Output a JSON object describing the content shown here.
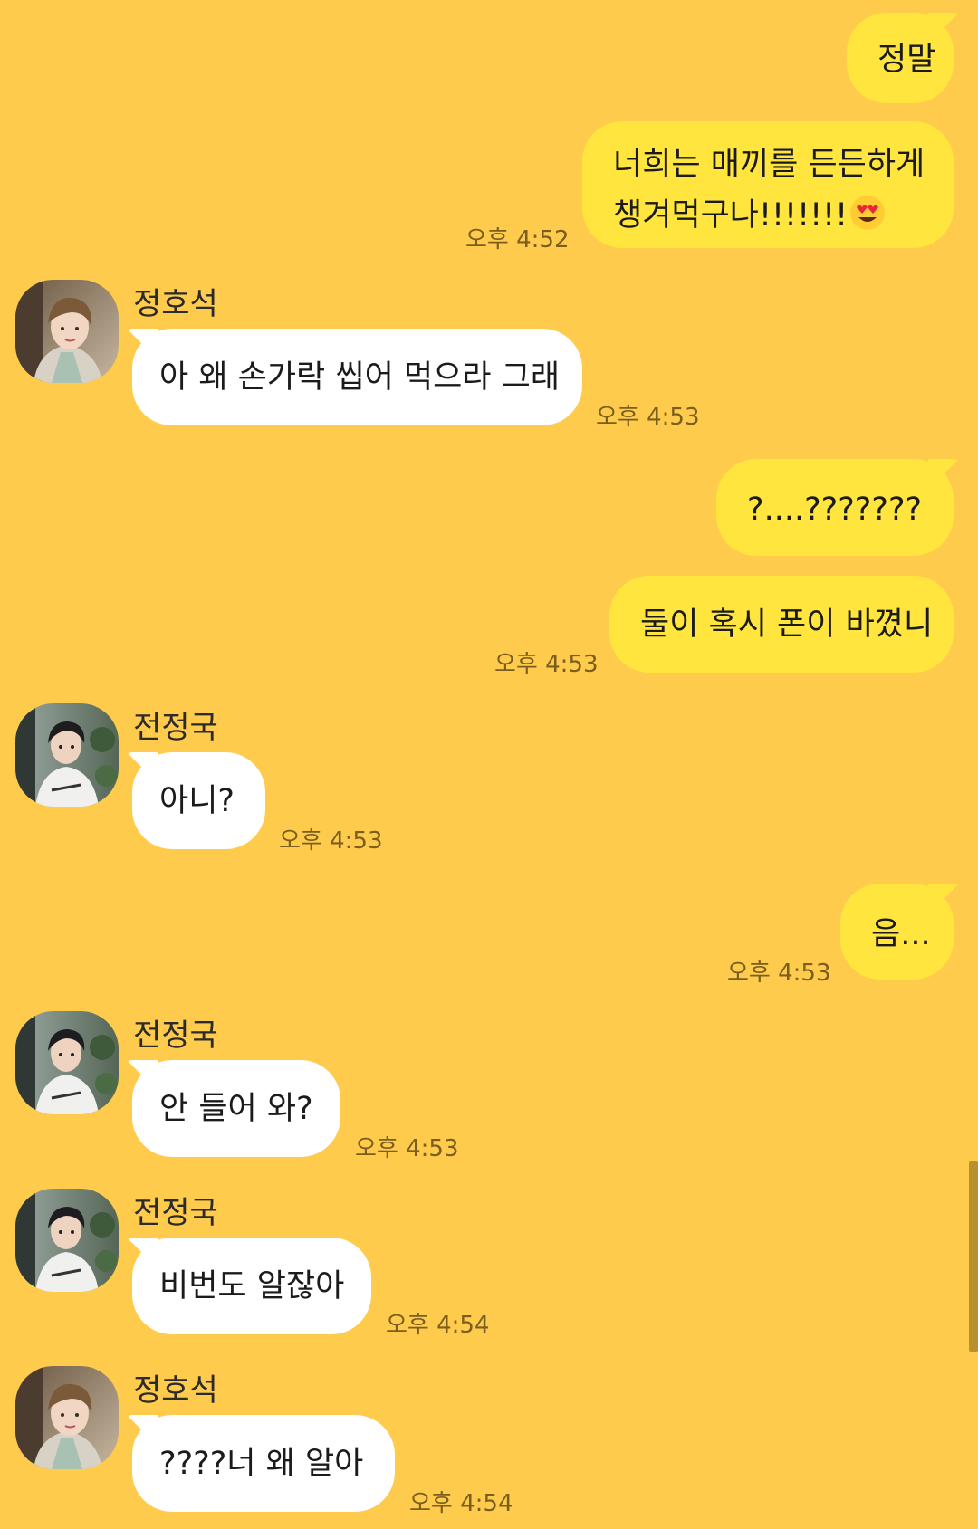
{
  "messages": [
    {
      "sender": "me",
      "text": "정말"
    },
    {
      "sender": "me",
      "line1": "너희는 매끼를 든든하게",
      "line2": "챙겨먹구나!!!!!!!",
      "emoji": "smiling-face-with-heart-eyes",
      "time": "오후 4:52"
    },
    {
      "sender": "정호석",
      "text": "아 왜 손가락 씹어 먹으라 그래",
      "time": "오후 4:53"
    },
    {
      "sender": "me",
      "text": "?....???????"
    },
    {
      "sender": "me",
      "text": "둘이 혹시 폰이 바꼈니",
      "time": "오후 4:53"
    },
    {
      "sender": "전정국",
      "text": "아니?",
      "time": "오후 4:53"
    },
    {
      "sender": "me",
      "text": "음...",
      "time": "오후 4:53"
    },
    {
      "sender": "전정국",
      "text": "안 들어 와?",
      "time": "오후 4:53"
    },
    {
      "sender": "전정국",
      "text": "비번도 알잖아",
      "time": "오후 4:54"
    },
    {
      "sender": "정호석",
      "text": "????너 왜 알아",
      "time": "오후 4:54"
    }
  ],
  "colors": {
    "background": "#ffcb4c",
    "my_bubble": "#ffe53d",
    "their_bubble": "#ffffff",
    "timestamp": "#7a5e1e"
  },
  "icons": {
    "avatar_hoseok": "avatar-photo",
    "avatar_jungkook": "avatar-photo",
    "emoji": "heart-eyes-emoji"
  }
}
